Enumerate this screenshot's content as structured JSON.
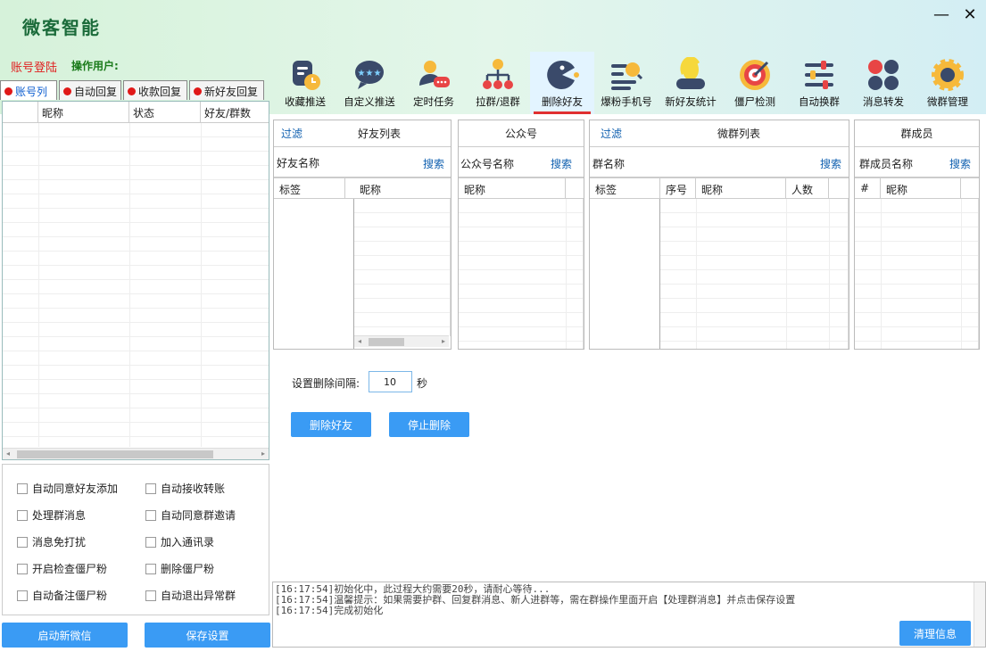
{
  "app": {
    "title": "微客智能",
    "min": "—",
    "close": "✕"
  },
  "account": {
    "login": "账号登陆",
    "operator": "操作用户:"
  },
  "toolbar": [
    {
      "name": "favorite-push",
      "label": "收藏推送",
      "icon": "doc-clock-icon"
    },
    {
      "name": "custom-push",
      "label": "自定义推送",
      "icon": "chat-stars-icon"
    },
    {
      "name": "scheduled-task",
      "label": "定时任务",
      "icon": "person-chat-icon"
    },
    {
      "name": "pull-exit-group",
      "label": "拉群/退群",
      "icon": "org-tree-icon"
    },
    {
      "name": "delete-friends",
      "label": "删除好友",
      "icon": "pacman-icon",
      "active": true
    },
    {
      "name": "boost-phone",
      "label": "爆粉手机号",
      "icon": "list-search-icon"
    },
    {
      "name": "new-friend-stats",
      "label": "新好友统计",
      "icon": "disk-icon"
    },
    {
      "name": "zombie-check",
      "label": "僵尸检测",
      "icon": "target-icon"
    },
    {
      "name": "auto-switch-group",
      "label": "自动换群",
      "icon": "sliders-icon"
    },
    {
      "name": "msg-forward",
      "label": "消息转发",
      "icon": "four-dots-icon"
    },
    {
      "name": "group-manage",
      "label": "微群管理",
      "icon": "gear-icon"
    }
  ],
  "left_tabs": [
    {
      "label": "账号列",
      "active": true
    },
    {
      "label": "自动回复"
    },
    {
      "label": "收款回复"
    },
    {
      "label": "新好友回复"
    }
  ],
  "left_grid": {
    "columns": [
      "",
      "昵称",
      "状态",
      "好友/群数"
    ]
  },
  "options": [
    "自动同意好友添加",
    "自动接收转账",
    "处理群消息",
    "自动同意群邀请",
    "消息免打扰",
    "加入通讯录",
    "开启检查僵尸粉",
    "删除僵尸粉",
    "自动备注僵尸粉",
    "自动退出异常群"
  ],
  "buttons": {
    "start_wechat": "启动新微信",
    "save_settings": "保存设置",
    "delete_friend": "删除好友",
    "stop_delete": "停止删除",
    "clear_info": "清理信息"
  },
  "friends_panel": {
    "filter": "过滤",
    "title": "好友列表",
    "search_label": "好友名称",
    "search": "搜索",
    "col_tag": "标签",
    "col_nick": "昵称"
  },
  "public_panel": {
    "title": "公众号",
    "search_label": "公众号名称",
    "search": "搜索",
    "col_nick": "昵称"
  },
  "group_panel": {
    "filter": "过滤",
    "title": "微群列表",
    "search_label": "群名称",
    "search": "搜索",
    "col_tag": "标签",
    "col_no": "序号",
    "col_nick": "昵称",
    "col_count": "人数"
  },
  "member_panel": {
    "title": "群成员",
    "search_label": "群成员名称",
    "search": "搜索",
    "col_hash": "#",
    "col_nick": "昵称"
  },
  "interval": {
    "label": "设置删除间隔:",
    "value": "10",
    "unit": "秒"
  },
  "log": [
    "[16:17:54]初始化中，此过程大约需要20秒，请耐心等待...",
    "[16:17:54]温馨提示：如果需要护群、回复群消息、新人进群等，需在群操作里面开启【处理群消息】并点击保存设置",
    "[16:17:54]完成初始化"
  ]
}
